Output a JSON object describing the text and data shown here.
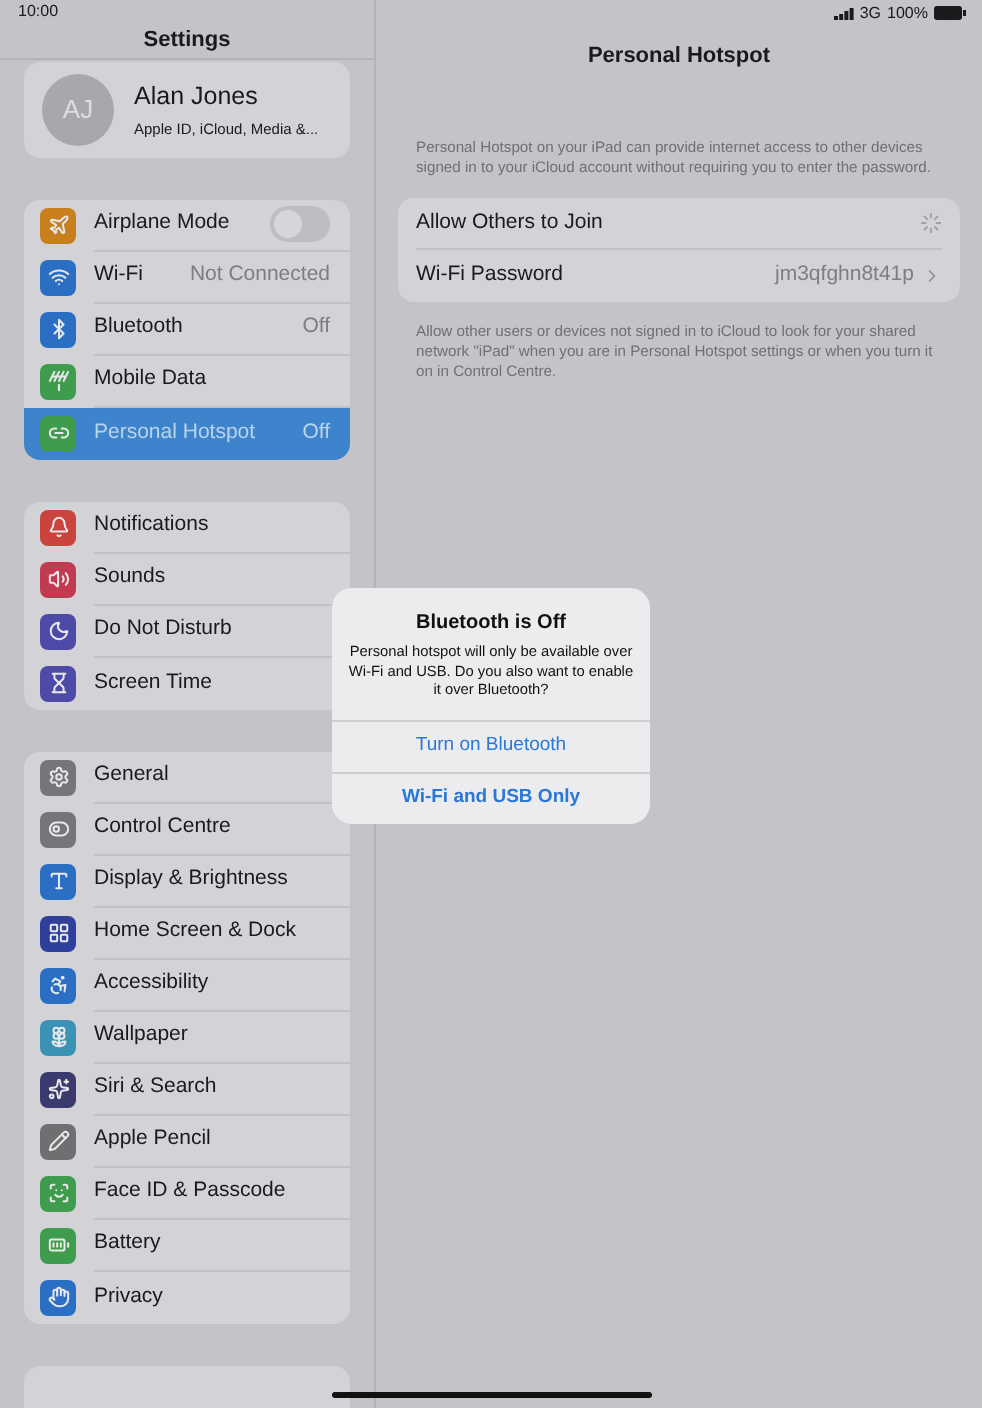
{
  "status_bar": {
    "time": "10:00",
    "network": "3G",
    "battery": "100%"
  },
  "sidebar": {
    "title": "Settings",
    "profile": {
      "initials": "AJ",
      "name": "Alan Jones",
      "subtitle": "Apple ID, iCloud, Media &..."
    },
    "groups": [
      {
        "items": [
          {
            "label": "Airplane Mode",
            "kind": "toggle",
            "on": false,
            "selected": false
          },
          {
            "label": "Wi-Fi",
            "kind": "value",
            "value": "Not Connected",
            "selected": false
          },
          {
            "label": "Bluetooth",
            "kind": "value",
            "value": "Off",
            "selected": false
          },
          {
            "label": "Mobile Data",
            "kind": "link",
            "selected": false
          },
          {
            "label": "Personal Hotspot",
            "kind": "value",
            "value": "Off",
            "selected": true
          }
        ]
      },
      {
        "items": [
          {
            "label": "Notifications",
            "kind": "link",
            "selected": false
          },
          {
            "label": "Sounds",
            "kind": "link",
            "selected": false
          },
          {
            "label": "Do Not Disturb",
            "kind": "link",
            "selected": false
          },
          {
            "label": "Screen Time",
            "kind": "link",
            "selected": false
          }
        ]
      },
      {
        "items": [
          {
            "label": "General",
            "kind": "link",
            "selected": false
          },
          {
            "label": "Control Centre",
            "kind": "link",
            "selected": false
          },
          {
            "label": "Display & Brightness",
            "kind": "link",
            "selected": false
          },
          {
            "label": "Home Screen & Dock",
            "kind": "link",
            "selected": false
          },
          {
            "label": "Accessibility",
            "kind": "link",
            "selected": false
          },
          {
            "label": "Wallpaper",
            "kind": "link",
            "selected": false
          },
          {
            "label": "Siri & Search",
            "kind": "link",
            "selected": false
          },
          {
            "label": "Apple Pencil",
            "kind": "link",
            "selected": false
          },
          {
            "label": "Face ID & Passcode",
            "kind": "link",
            "selected": false
          },
          {
            "label": "Battery",
            "kind": "link",
            "selected": false
          },
          {
            "label": "Privacy",
            "kind": "link",
            "selected": false
          }
        ]
      }
    ]
  },
  "detail": {
    "title": "Personal Hotspot",
    "intro": "Personal Hotspot on your iPad can provide internet access to other devices signed in to your iCloud account without requiring you to enter the password.",
    "rows": [
      {
        "label": "Allow Others to Join",
        "kind": "loading"
      },
      {
        "label": "Wi-Fi Password",
        "kind": "value",
        "value": "jm3qfghn8t41p"
      }
    ],
    "footer": "Allow other users or devices not signed in to iCloud to look for your shared network \"iPad\" when you are in Personal Hotspot settings or when you turn it on in Control Centre."
  },
  "alert": {
    "title": "Bluetooth is Off",
    "message": "Personal hotspot will only be available over Wi-Fi and USB. Do you also want to enable it over Bluetooth?",
    "buttons": [
      {
        "label": "Turn on Bluetooth",
        "bold": false
      },
      {
        "label": "Wi-Fi and USB Only",
        "bold": true
      }
    ]
  }
}
